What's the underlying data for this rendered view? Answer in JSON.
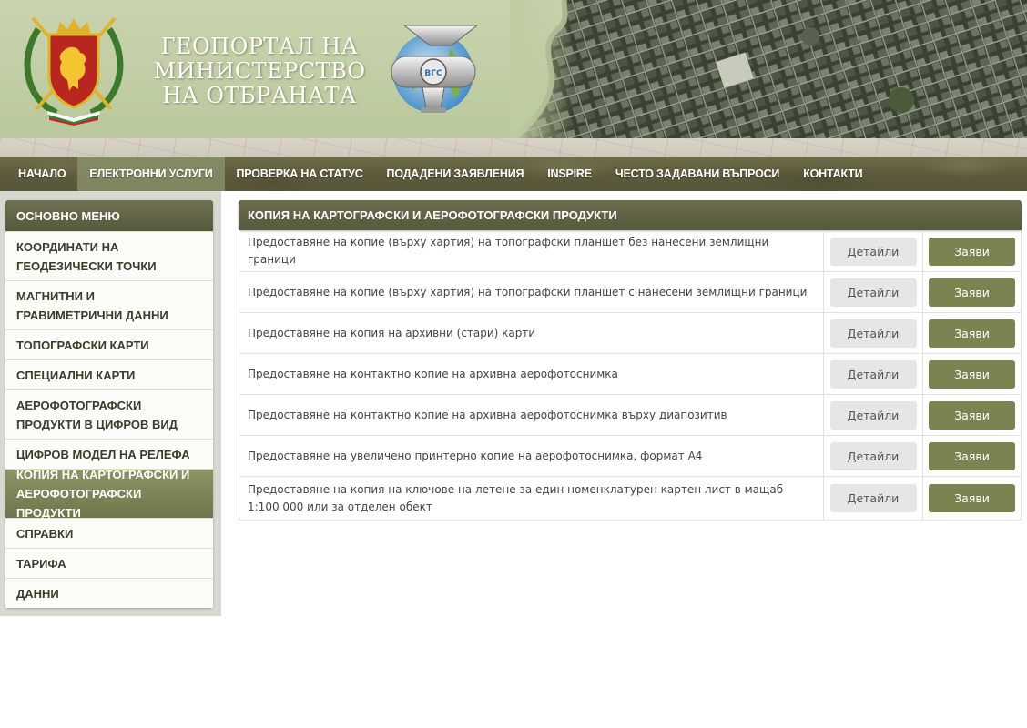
{
  "header": {
    "title_lines": [
      "ГЕОПОРТАЛ НА",
      "МИНИСТЕРСТВО",
      "НА ОТБРАНАТА"
    ],
    "logo_text": "ВГС"
  },
  "nav": {
    "items": [
      {
        "label": "НАЧАЛО"
      },
      {
        "label": "ЕЛЕКТРОННИ УСЛУГИ"
      },
      {
        "label": "ПРОВЕРКА НА СТАТУС"
      },
      {
        "label": "ПОДАДЕНИ ЗАЯВЛЕНИЯ"
      },
      {
        "label": "INSPIRE"
      },
      {
        "label": "ЧЕСТО ЗАДАВАНИ ВЪПРОСИ"
      },
      {
        "label": "КОНТАКТИ"
      }
    ],
    "active_index": 1
  },
  "sidebar": {
    "title": "ОСНОВНО МЕНЮ",
    "items": [
      {
        "label": "КООРДИНАТИ НА ГЕОДЕЗИЧЕСКИ ТОЧКИ"
      },
      {
        "label": "МАГНИТНИ И ГРАВИМЕТРИЧНИ ДАННИ"
      },
      {
        "label": "ТОПОГРАФСКИ КАРТИ"
      },
      {
        "label": "СПЕЦИАЛНИ КАРТИ"
      },
      {
        "label": "АЕРОФОТОГРАФСКИ ПРОДУКТИ В ЦИФРОВ ВИД"
      },
      {
        "label": "ЦИФРОВ МОДЕЛ НА РЕЛЕФА"
      },
      {
        "label": "КОПИЯ НА КАРТОГРАФСКИ И АЕРОФОТОГРАФСКИ ПРОДУКТИ"
      },
      {
        "label": "СПРАВКИ"
      },
      {
        "label": "ТАРИФА"
      },
      {
        "label": "ДАННИ"
      }
    ],
    "active_index": 6
  },
  "content": {
    "title": "КОПИЯ НА КАРТОГРАФСКИ И АЕРОФОТОГРАФСКИ ПРОДУКТИ",
    "details_label": "Детайли",
    "apply_label": "Заяви",
    "services": [
      {
        "name": "Предоставяне на копие (върху хартия) на топографски планшет без нанесени землищни граници"
      },
      {
        "name": "Предоставяне на копие (върху хартия) на топографски планшет с нанесени землищни граници"
      },
      {
        "name": "Предоставяне на копия на архивни (стари) карти"
      },
      {
        "name": "Предоставяне на контактно копие на архивна аерофотоснимка"
      },
      {
        "name": "Предоставяне на контактно копие на архивна аерофотоснимка върху диапозитив"
      },
      {
        "name": "Предоставяне на увеличено принтерно копие на аерофотоснимка, формат А4"
      },
      {
        "name": "Предоставяне на копия на ключове на летене за един номенклатурен картен лист в мащаб 1:100 000 или за отделен обект"
      }
    ]
  },
  "colors": {
    "nav_bg": "#5e5b3c",
    "accent": "#7b8451",
    "header_bg": "#c9d4ae"
  }
}
